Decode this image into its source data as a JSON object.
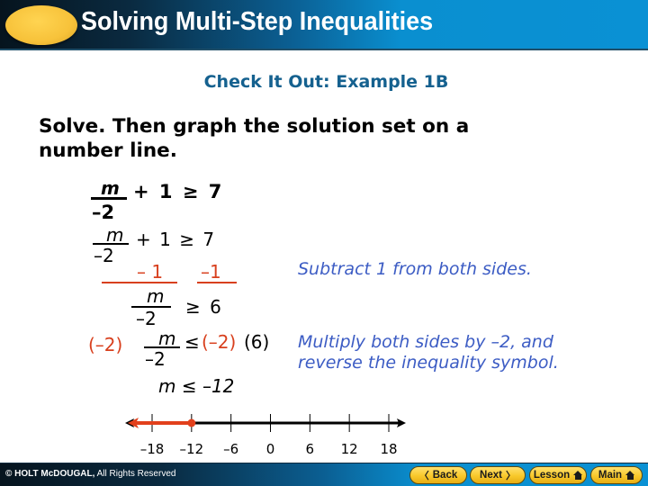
{
  "header": {
    "title": "Solving Multi-Step Inequalities",
    "logo_icon": "yellow-oval-icon"
  },
  "subtitle": "Check It Out: Example 1B",
  "prompt": "Solve. Then graph the solution set on a number line.",
  "steps": {
    "problem": {
      "numerator": "m",
      "denominator": "–2",
      "rest": "+ 1 ≥ 7"
    },
    "step1": {
      "numerator": "m",
      "denominator": "–2",
      "rest": "+ 1 ≥ 7",
      "sub_left": "– 1",
      "sub_right": "–1",
      "note": "Subtract 1 from both sides."
    },
    "step2": {
      "numerator": "m",
      "denominator": "–2",
      "rest": "≥  6"
    },
    "step3": {
      "left_mult": "(–2)",
      "numerator": "m",
      "denominator": "–2",
      "ineq": "≤",
      "right_mult": "(–2)",
      "right_val": "(6)",
      "note_line1": "Multiply both sides by –2, and",
      "note_line2": "reverse the inequality symbol."
    },
    "solution": "m ≤ –12"
  },
  "number_line": {
    "ticks": [
      "–18",
      "–12",
      "–6",
      "0",
      "6",
      "12",
      "18"
    ],
    "tick_values": [
      -18,
      -12,
      -6,
      0,
      6,
      12,
      18
    ],
    "solution_endpoint": -12,
    "endpoint_type": "closed",
    "direction": "left",
    "solution_color": "#e2401c",
    "axis_color": "#000000"
  },
  "footer": {
    "copyright_bold": "© HOLT McDOUGAL,",
    "copyright_rest": " All Rights Reserved",
    "buttons": {
      "back": "Back",
      "next": "Next",
      "lesson": "Lesson",
      "main": "Main"
    }
  },
  "colors": {
    "subtitle": "#15618f",
    "note": "#3c5cc4",
    "highlight": "#d8401e",
    "button": "#f8c82a"
  }
}
